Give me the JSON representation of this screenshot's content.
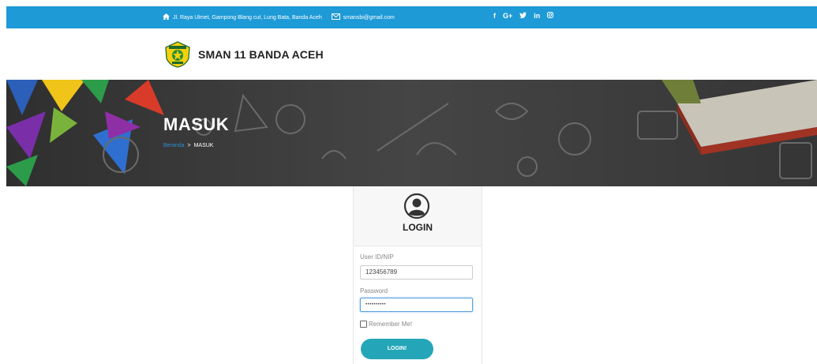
{
  "topbar": {
    "address": "Jl. Raya Ulmet, Gampong Blang cut, Lung Bata, Banda Aceh",
    "email": "smansbi@gmail.com",
    "social": {
      "facebook": "f",
      "google": "G+",
      "twitter": "t",
      "linkedin": "in",
      "instagram": "ig"
    },
    "color": "#1e9ad6"
  },
  "brand": {
    "name": "SMAN 11 BANDA ACEH"
  },
  "hero": {
    "title": "MASUK",
    "breadcrumb": {
      "home": "Beranda",
      "separator": ">",
      "current": "MASUK"
    }
  },
  "login": {
    "title": "LOGIN",
    "user_label": "User ID/NIP",
    "user_value": "123456789",
    "password_label": "Password",
    "password_value": "••••••••••",
    "remember_label": "Remember Me!",
    "remember_checked": false,
    "button_label": "LOGIN!",
    "button_color": "#25a6b8"
  }
}
